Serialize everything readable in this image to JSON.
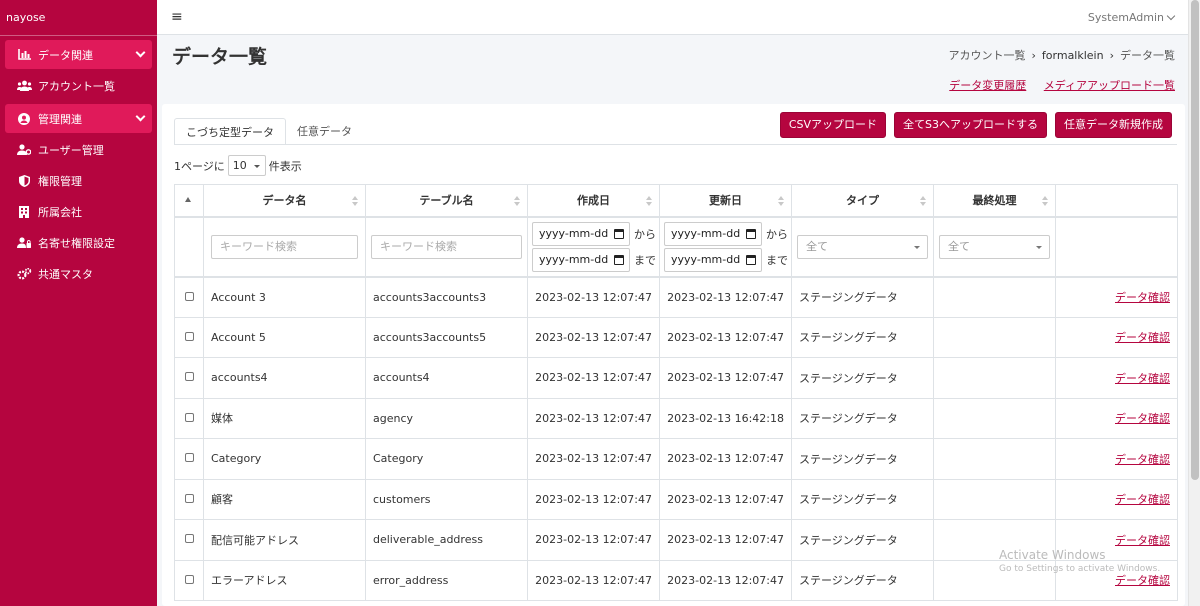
{
  "sidebar": {
    "brand": "nayose",
    "items": [
      {
        "label": "データ関連",
        "icon": "chart-bar-icon",
        "active": true,
        "expandable": true
      },
      {
        "label": "アカウント一覧",
        "icon": "users-icon"
      },
      {
        "label": "管理関連",
        "icon": "user-circle-icon",
        "active": true,
        "expandable": true
      },
      {
        "label": "ユーザー管理",
        "icon": "user-cog-icon"
      },
      {
        "label": "権限管理",
        "icon": "shield-icon"
      },
      {
        "label": "所属会社",
        "icon": "building-icon"
      },
      {
        "label": "名寄せ権限設定",
        "icon": "user-lock-icon"
      },
      {
        "label": "共通マスタ",
        "icon": "cogs-icon"
      }
    ]
  },
  "topbar": {
    "menu_icon": "≡",
    "user": "SystemAdmin"
  },
  "page": {
    "title": "データ一覧",
    "breadcrumb": [
      "アカウント一覧",
      "formalklein",
      "データ一覧"
    ],
    "links": [
      "データ変更履歴",
      "メディアアップロード一覧"
    ]
  },
  "tabs": [
    "こづち定型データ",
    "任意データ"
  ],
  "buttons": [
    "CSVアップロード",
    "全てS3へアップロードする",
    "任意データ新規作成"
  ],
  "pager": {
    "prefix": "1ページに",
    "value": "10",
    "suffix": "件表示"
  },
  "table": {
    "columns": [
      "データ名",
      "テーブル名",
      "作成日",
      "更新日",
      "タイプ",
      "最終処理"
    ],
    "filters": {
      "keyword_placeholder": "キーワード検索",
      "date_placeholder": "yyyy-mm-dd",
      "from": "から",
      "to": "まで",
      "all": "全て"
    },
    "rows": [
      {
        "name": "Account 3",
        "table": "accounts3accounts3",
        "created": "2023-02-13 12:07:47",
        "updated": "2023-02-13 12:07:47",
        "type": "ステージングデータ",
        "action": "データ確認"
      },
      {
        "name": "Account 5",
        "table": "accounts3accounts5",
        "created": "2023-02-13 12:07:47",
        "updated": "2023-02-13 12:07:47",
        "type": "ステージングデータ",
        "action": "データ確認"
      },
      {
        "name": "accounts4",
        "table": "accounts4",
        "created": "2023-02-13 12:07:47",
        "updated": "2023-02-13 12:07:47",
        "type": "ステージングデータ",
        "action": "データ確認"
      },
      {
        "name": "媒体",
        "table": "agency",
        "created": "2023-02-13 12:07:47",
        "updated": "2023-02-13 16:42:18",
        "type": "ステージングデータ",
        "action": "データ確認"
      },
      {
        "name": "Category",
        "table": "Category",
        "created": "2023-02-13 12:07:47",
        "updated": "2023-02-13 12:07:47",
        "type": "ステージングデータ",
        "action": "データ確認"
      },
      {
        "name": "顧客",
        "table": "customers",
        "created": "2023-02-13 12:07:47",
        "updated": "2023-02-13 12:07:47",
        "type": "ステージングデータ",
        "action": "データ確認"
      },
      {
        "name": "配信可能アドレス",
        "table": "deliverable_address",
        "created": "2023-02-13 12:07:47",
        "updated": "2023-02-13 12:07:47",
        "type": "ステージングデータ",
        "action": "データ確認"
      },
      {
        "name": "エラーアドレス",
        "table": "error_address",
        "created": "2023-02-13 12:07:47",
        "updated": "2023-02-13 12:07:47",
        "type": "ステージングデータ",
        "action": "データ確認"
      }
    ]
  },
  "watermark": {
    "line1": "Activate Windows",
    "line2": "Go to Settings to activate Windows."
  },
  "colors": {
    "brand": "#b5053f",
    "brand_active": "#e01a5a"
  }
}
